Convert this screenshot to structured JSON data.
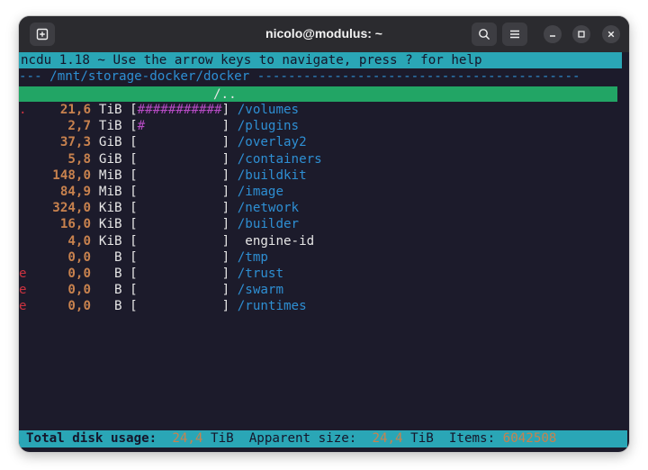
{
  "window": {
    "title": "nicolo@modulus: ~"
  },
  "header": {
    "text": "ncdu 1.18 ~ Use the arrow keys to navigate, press ? for help"
  },
  "pathline": {
    "prefix": "--- ",
    "path": "/mnt/storage-docker/docker",
    "suffix": " ------------------------------------------"
  },
  "selected": {
    "label": "/.."
  },
  "entries": [
    {
      "mark": ".",
      "size": "21,6",
      "unit": "TiB",
      "bar": "###########",
      "name": "/volumes",
      "dir": true
    },
    {
      "mark": "",
      "size": "2,7",
      "unit": "TiB",
      "bar": "#",
      "name": "/plugins",
      "dir": true
    },
    {
      "mark": "",
      "size": "37,3",
      "unit": "GiB",
      "bar": "",
      "name": "/overlay2",
      "dir": true
    },
    {
      "mark": "",
      "size": "5,8",
      "unit": "GiB",
      "bar": "",
      "name": "/containers",
      "dir": true
    },
    {
      "mark": "",
      "size": "148,0",
      "unit": "MiB",
      "bar": "",
      "name": "/buildkit",
      "dir": true
    },
    {
      "mark": "",
      "size": "84,9",
      "unit": "MiB",
      "bar": "",
      "name": "/image",
      "dir": true
    },
    {
      "mark": "",
      "size": "324,0",
      "unit": "KiB",
      "bar": "",
      "name": "/network",
      "dir": true
    },
    {
      "mark": "",
      "size": "16,0",
      "unit": "KiB",
      "bar": "",
      "name": "/builder",
      "dir": true
    },
    {
      "mark": "",
      "size": "4,0",
      "unit": "KiB",
      "bar": "",
      "name": " engine-id",
      "dir": false
    },
    {
      "mark": "",
      "size": "0,0",
      "unit": "B",
      "bar": "",
      "name": "/tmp",
      "dir": true
    },
    {
      "mark": "e",
      "size": "0,0",
      "unit": "B",
      "bar": "",
      "name": "/trust",
      "dir": true
    },
    {
      "mark": "e",
      "size": "0,0",
      "unit": "B",
      "bar": "",
      "name": "/swarm",
      "dir": true
    },
    {
      "mark": "e",
      "size": "0,0",
      "unit": "B",
      "bar": "",
      "name": "/runtimes",
      "dir": true
    }
  ],
  "status": {
    "total_label": "Total disk usage:",
    "total_value": "24,4",
    "total_unit": "TiB",
    "apparent_label": "Apparent size:",
    "apparent_value": "24,4",
    "apparent_unit": "TiB",
    "items_label": "Items:",
    "items_value": "6042508"
  },
  "colors": {
    "terminal_bg": "#1c1b2b",
    "header_bg": "#2aa6b6",
    "selection_bg": "#22a565",
    "dir_blue": "#2e8fd3",
    "size_orange": "#c8824e",
    "bar_purple": "#b64bc4",
    "error_red": "#cc3340"
  }
}
